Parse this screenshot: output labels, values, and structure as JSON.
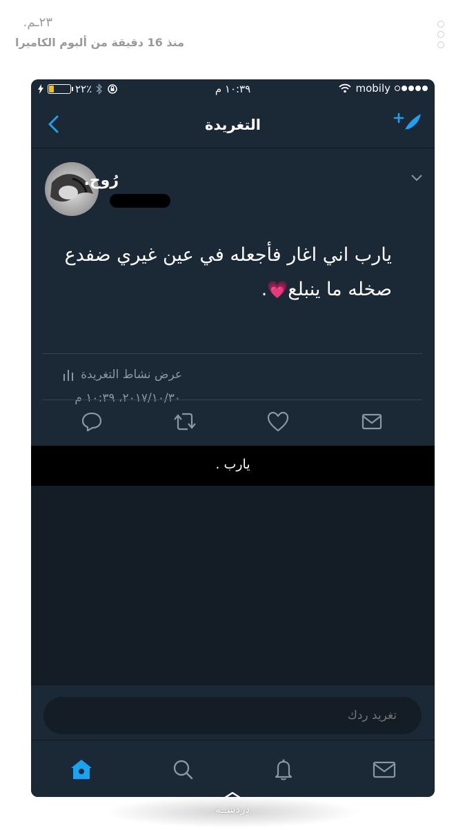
{
  "story": {
    "title": "٢٣ـم.",
    "subtitle": "منذ 16 دقيقة من ألبوم الكاميرا"
  },
  "status_bar": {
    "battery": "٢٢٪",
    "time": "١٠:٣٩ م",
    "carrier": "mobily",
    "signal_bars_filled": 4,
    "signal_bars_total": 5,
    "battery_level": 0.22
  },
  "nav": {
    "title": "التغريدة",
    "back_icon": "chevron-left-icon",
    "compose_icon": "compose-tweet-icon"
  },
  "tweet": {
    "author_name": "رُوح.",
    "text_line1": "يارب اني اغار فأجعله في عين غيري ضفدع",
    "text_line2": "صخله ما ينبلع",
    "emoji": "💗",
    "text_end": ".",
    "timestamp": "٢٠١٧/١٠/٣٠، ١٠:٣٩ م",
    "activity_label": "عرض نشاط التغريدة"
  },
  "actions": {
    "reply": "reply-icon",
    "retweet": "retweet-icon",
    "like": "heart-icon",
    "dm": "envelope-icon"
  },
  "reply_strip": {
    "text": "يارب ."
  },
  "composer": {
    "placeholder": "تغريد ردك"
  },
  "tabs": [
    "home-icon",
    "search-icon",
    "notifications-bell-icon",
    "messages-envelope-icon"
  ],
  "bottom_hint": {
    "label": "دردشــة"
  },
  "colors": {
    "background": "#1b2836",
    "accent": "#1da1f2",
    "muted": "#8899a6"
  }
}
